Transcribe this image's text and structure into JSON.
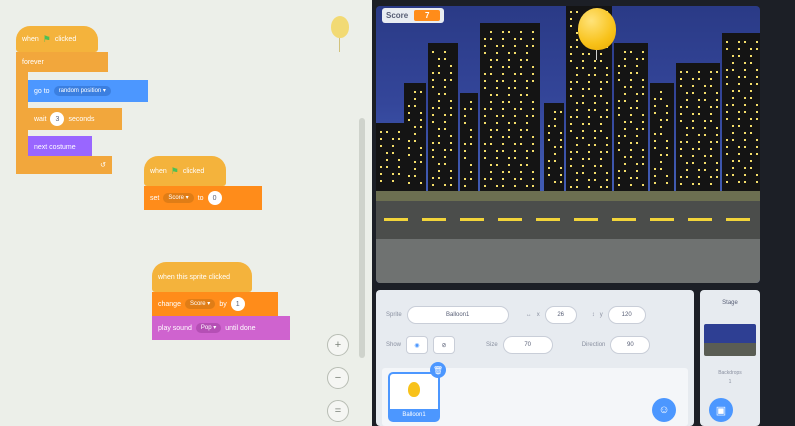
{
  "workspace": {
    "script1": {
      "when_flag": "when",
      "when_flag_suffix": "clicked",
      "forever": "forever",
      "goto": "go to",
      "goto_target": "random position ▾",
      "wait": "wait",
      "wait_value": "3",
      "wait_unit": "seconds",
      "next_costume": "next costume",
      "loop_arrow": "↺"
    },
    "script2": {
      "when_flag": "when",
      "when_flag_suffix": "clicked",
      "set": "set",
      "var": "Score ▾",
      "to": "to",
      "value": "0"
    },
    "script3": {
      "hat": "when this sprite clicked",
      "change": "change",
      "var": "Score ▾",
      "by": "by",
      "value": "1",
      "play_sound": "play sound",
      "sound": "Pop ▾",
      "until": "until done"
    },
    "zoom": {
      "in": "+",
      "out": "−",
      "reset": "="
    }
  },
  "stage": {
    "monitor_label": "Score",
    "monitor_value": "7"
  },
  "sprite_info": {
    "sprite_label": "Sprite",
    "sprite_name": "Balloon1",
    "x_label": "x",
    "x_value": "26",
    "y_label": "y",
    "y_value": "120",
    "show_label": "Show",
    "size_label": "Size",
    "size_value": "70",
    "direction_label": "Direction",
    "direction_value": "90",
    "sprite_tile_label": "Balloon1"
  },
  "stage_panel": {
    "title": "Stage",
    "backdrops_label": "Backdrops",
    "backdrops_count": "1"
  },
  "colors": {
    "events": "#f4b33c",
    "motion": "#4c97ff",
    "looks": "#9966ff",
    "variables": "#ff8c1a",
    "sound": "#cf63cf"
  }
}
